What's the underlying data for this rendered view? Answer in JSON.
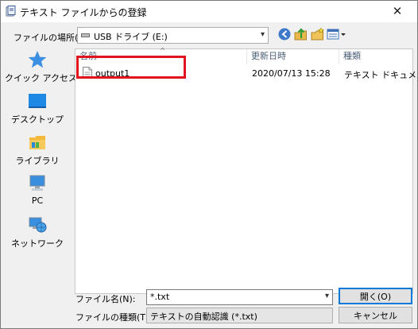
{
  "window": {
    "title": "テキスト ファイルからの登録",
    "close_glyph": "✕"
  },
  "lookin": {
    "label": "ファイルの場所(I):",
    "value": "USB ドライブ (E:)"
  },
  "places": [
    {
      "label": "クイック アクセス",
      "icon": "star-icon"
    },
    {
      "label": "デスクトップ",
      "icon": "desktop-icon"
    },
    {
      "label": "ライブラリ",
      "icon": "library-icon"
    },
    {
      "label": "PC",
      "icon": "pc-icon"
    },
    {
      "label": "ネットワーク",
      "icon": "network-icon"
    }
  ],
  "filelist": {
    "columns": [
      "名前",
      "更新日時",
      "種類"
    ],
    "rows": [
      {
        "name": "output1",
        "modified": "2020/07/13 15:28",
        "type": "テキスト ドキュメント"
      }
    ]
  },
  "filename": {
    "label": "ファイル名(N):",
    "value": "*.txt"
  },
  "filetype": {
    "label": "ファイルの種類(T):",
    "value": "テキストの自動認識 (*.txt)"
  },
  "buttons": {
    "open": "開く(O)",
    "cancel": "キャンセル"
  }
}
